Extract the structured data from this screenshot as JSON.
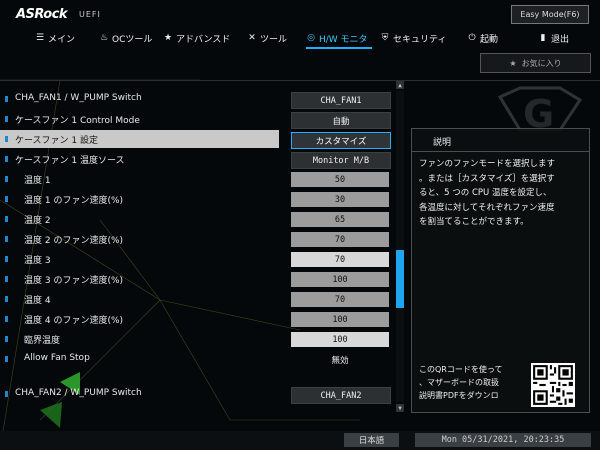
{
  "header": {
    "logo": "ASRock",
    "uefi": "UEFI",
    "easy_mode_label": "Easy Mode(F6)"
  },
  "nav": {
    "items": [
      {
        "label": "メイン",
        "icon": "list-icon"
      },
      {
        "label": "OCツール",
        "icon": "flame-icon"
      },
      {
        "label": "アドバンスド",
        "icon": "star-icon"
      },
      {
        "label": "ツール",
        "icon": "tools-icon"
      },
      {
        "label": "H/W モニタ",
        "icon": "monitor-icon"
      },
      {
        "label": "セキュリティ",
        "icon": "shield-icon"
      },
      {
        "label": "起動",
        "icon": "power-icon"
      },
      {
        "label": "退出",
        "icon": "exit-icon"
      }
    ],
    "active_index": 4
  },
  "favorites_label": "お気に入り",
  "settings": {
    "rows": [
      {
        "label": "CHA_FAN1 / W_PUMP Switch",
        "value": "CHA_FAN1",
        "style": "btn"
      },
      {
        "label": "ケースファン 1 Control Mode",
        "value": "自動",
        "style": "btn"
      },
      {
        "label": "ケースファン 1 設定",
        "value": "カスタマイズ",
        "style": "sel",
        "selected": true
      },
      {
        "label": "ケースファン 1 温度ソース",
        "value": "Monitor M/B",
        "style": "btn"
      },
      {
        "label": "温度 1",
        "value": "50",
        "style": "num",
        "indent": true
      },
      {
        "label": "温度 1 のファン速度(%)",
        "value": "30",
        "style": "num",
        "indent": true
      },
      {
        "label": "温度 2",
        "value": "65",
        "style": "num",
        "indent": true
      },
      {
        "label": "温度 2 のファン速度(%)",
        "value": "70",
        "style": "num",
        "indent": true
      },
      {
        "label": "温度 3",
        "value": "70",
        "style": "bright",
        "indent": true
      },
      {
        "label": "温度 3 のファン速度(%)",
        "value": "100",
        "style": "num",
        "indent": true
      },
      {
        "label": "温度 4",
        "value": "70",
        "style": "num",
        "indent": true
      },
      {
        "label": "温度 4 のファン速度(%)",
        "value": "100",
        "style": "num",
        "indent": true
      },
      {
        "label": "臨界温度",
        "value": "100",
        "style": "bright",
        "indent": true
      },
      {
        "label": "Allow Fan Stop",
        "value": "無効",
        "style": "plain",
        "indent": true
      },
      {
        "label": "CHA_FAN2 / W_PUMP Switch",
        "value": "CHA_FAN2",
        "style": "btn",
        "gap": true
      }
    ]
  },
  "description": {
    "title": "説明",
    "lines": [
      "ファンのファンモードを選択します",
      "。または［カスタマイズ］を選択す",
      "ると、5 つの CPU 温度を設定し、",
      "各温度に対してそれぞれファン速度",
      "を割当てることができます。"
    ],
    "qr_lines": [
      "このQRコードを使って",
      "、マザーボードの取扱",
      "説明書PDFをダウンロ"
    ]
  },
  "footer": {
    "language": "日本語",
    "datetime": "Mon 05/31/2021, 20:23:35"
  },
  "colors": {
    "accent": "#1fb0ff",
    "background": "#05080a",
    "bullet": "#1e88c9"
  }
}
